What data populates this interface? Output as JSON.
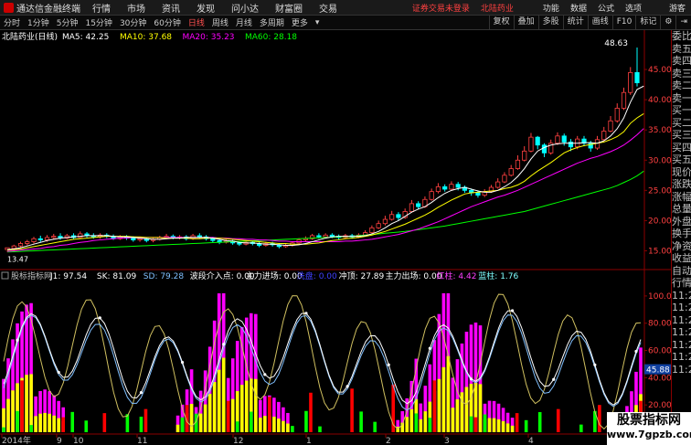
{
  "menubar": {
    "app": "通达信金融终端",
    "items": [
      "行情",
      "市场",
      "资讯",
      "发现",
      "问小达",
      "财富圈",
      "交易"
    ],
    "warning": "证券交易未登录",
    "stock_link": "北陆药业",
    "right": [
      "功能",
      "数据",
      "公式",
      "选项"
    ],
    "user": "游客"
  },
  "toolbar": {
    "periods": [
      "分时",
      "1分钟",
      "5分钟",
      "15分钟",
      "30分钟",
      "60分钟",
      "日线",
      "周线",
      "月线",
      "多周期",
      "更多"
    ],
    "active_period": "日线",
    "buttons": [
      "复权",
      "叠加",
      "多股",
      "统计",
      "画线",
      "F10",
      "标记"
    ],
    "icons": [
      "gear-icon",
      "collapse-icon"
    ]
  },
  "kline": {
    "title": "北陆药业(日线)",
    "ma_labels": [
      {
        "text": "MA5: 42.25",
        "color": "#ffffff"
      },
      {
        "text": "MA10: 37.68",
        "color": "#ffff00"
      },
      {
        "text": "MA20: 35.23",
        "color": "#ff00ff"
      },
      {
        "text": "MA60: 28.18",
        "color": "#00ff00"
      }
    ],
    "y_ticks": [
      "45.00",
      "40.00",
      "35.00",
      "30.00",
      "25.00",
      "20.00",
      "15.00"
    ],
    "high_label": "48.63",
    "low_label": "13.47",
    "candles": [
      [
        15.2,
        15.5,
        15,
        14.8
      ],
      [
        15.4,
        15.8,
        16,
        15.1
      ],
      [
        15.8,
        16.2,
        16.5,
        15.5
      ],
      [
        16.2,
        16.5,
        16.8,
        15.9
      ],
      [
        16.5,
        17,
        17.3,
        16.2
      ],
      [
        17,
        16.8,
        17.5,
        16.4
      ],
      [
        16.8,
        17.2,
        17.6,
        16.5
      ],
      [
        17.2,
        17.4,
        17.8,
        16.9
      ],
      [
        17.4,
        17.1,
        17.9,
        16.8
      ],
      [
        17.1,
        17.5,
        17.8,
        16.9
      ],
      [
        17.5,
        17.2,
        17.9,
        16.9
      ],
      [
        17.2,
        17.8,
        18.2,
        17
      ],
      [
        17.8,
        17.5,
        18.1,
        17.2
      ],
      [
        17.5,
        17.3,
        17.9,
        17
      ],
      [
        17.3,
        17.6,
        17.9,
        17
      ],
      [
        17.6,
        17.4,
        17.9,
        17.1
      ],
      [
        17.4,
        17,
        17.7,
        16.8
      ],
      [
        17,
        17.3,
        17.6,
        16.8
      ],
      [
        17.3,
        17.1,
        17.6,
        16.8
      ],
      [
        17.1,
        16.8,
        17.4,
        16.5
      ],
      [
        16.8,
        17,
        17.3,
        16.5
      ],
      [
        17,
        16.7,
        17.2,
        16.4
      ],
      [
        16.7,
        16.9,
        17.1,
        16.4
      ],
      [
        16.9,
        17.2,
        17.5,
        16.7
      ],
      [
        17.2,
        17.4,
        17.8,
        17
      ],
      [
        17.4,
        17.1,
        17.7,
        16.9
      ],
      [
        17.1,
        17.3,
        17.6,
        16.9
      ],
      [
        17.3,
        17,
        17.6,
        16.7
      ],
      [
        17,
        17.5,
        17.8,
        16.8
      ],
      [
        17.5,
        17.3,
        17.9,
        17
      ],
      [
        17.3,
        17,
        17.6,
        16.7
      ],
      [
        17,
        16.7,
        17.3,
        16.4
      ],
      [
        16.7,
        16.4,
        17,
        16.1
      ],
      [
        16.4,
        16.6,
        16.9,
        16.2
      ],
      [
        16.6,
        16.3,
        16.8,
        16
      ],
      [
        16.3,
        16.1,
        16.6,
        15.8
      ],
      [
        16.1,
        16.4,
        16.7,
        15.9
      ],
      [
        16.4,
        16.2,
        16.6,
        15.9
      ],
      [
        16.2,
        15.9,
        16.5,
        15.6
      ],
      [
        15.9,
        16.2,
        16.5,
        15.7
      ],
      [
        16.2,
        16,
        16.5,
        15.7
      ],
      [
        16,
        15.7,
        16.3,
        15.4
      ],
      [
        15.7,
        15.9,
        16.2,
        15.5
      ],
      [
        15.9,
        16.3,
        16.6,
        15.7
      ],
      [
        16.3,
        16.8,
        17.1,
        16.1
      ],
      [
        16.8,
        17,
        17.4,
        16.5
      ],
      [
        17,
        17.5,
        17.8,
        16.8
      ],
      [
        17.5,
        17.3,
        17.9,
        17
      ],
      [
        17.3,
        17.6,
        17.9,
        17.1
      ],
      [
        17.6,
        17.4,
        17.9,
        17.1
      ],
      [
        17.4,
        17.2,
        17.7,
        16.9
      ],
      [
        17.2,
        17.5,
        17.8,
        17
      ],
      [
        17.5,
        17.3,
        17.8,
        17
      ],
      [
        17.3,
        17.6,
        17.9,
        17.1
      ],
      [
        17.6,
        18,
        18.4,
        17.4
      ],
      [
        18,
        18.8,
        19.2,
        17.8
      ],
      [
        18.8,
        19.5,
        20,
        18.6
      ],
      [
        19.5,
        20.2,
        20.8,
        19.2
      ],
      [
        20.2,
        21,
        21.6,
        20
      ],
      [
        21,
        20.5,
        21.4,
        20
      ],
      [
        20.5,
        21.5,
        22,
        20.3
      ],
      [
        21.5,
        22.8,
        23.4,
        21.3
      ],
      [
        22.8,
        22.3,
        23.2,
        21.9
      ],
      [
        22.3,
        23.5,
        24,
        22.1
      ],
      [
        23.5,
        24.8,
        25.3,
        23.3
      ],
      [
        24.8,
        25.6,
        26.2,
        24.5
      ],
      [
        25.6,
        25.2,
        26,
        24.8
      ],
      [
        25.2,
        26,
        26.5,
        25
      ],
      [
        26,
        25.5,
        26.4,
        25
      ],
      [
        25.5,
        25,
        25.8,
        24.6
      ],
      [
        25,
        24.6,
        25.3,
        24.1
      ],
      [
        24.6,
        24.2,
        25,
        23.8
      ],
      [
        24.2,
        24.8,
        25.2,
        23.9
      ],
      [
        24.8,
        25.5,
        25.9,
        24.6
      ],
      [
        25.5,
        26.4,
        27,
        25.3
      ],
      [
        26.4,
        27.5,
        28,
        26.2
      ],
      [
        27.5,
        28.6,
        29.2,
        27.3
      ],
      [
        28.6,
        30,
        30.8,
        28.4
      ],
      [
        30,
        31.5,
        32.3,
        29.8
      ],
      [
        31.5,
        33.8,
        34.5,
        31.3
      ],
      [
        33.8,
        32.5,
        34,
        31.8
      ],
      [
        32.5,
        31.2,
        32.8,
        30.5
      ],
      [
        31.2,
        32.8,
        33.4,
        30.9
      ],
      [
        32.8,
        34,
        34.6,
        32.5
      ],
      [
        34,
        33,
        34.4,
        32.4
      ],
      [
        33,
        32.2,
        33.5,
        31.5
      ],
      [
        32.2,
        33.5,
        34,
        31.8
      ],
      [
        33.5,
        32.8,
        34,
        32.3
      ],
      [
        32.8,
        32,
        33.2,
        31.4
      ],
      [
        32,
        33.4,
        34,
        31.7
      ],
      [
        33.4,
        34.8,
        35.5,
        33.1
      ],
      [
        34.8,
        36.5,
        37.3,
        34.6
      ],
      [
        36.5,
        38.6,
        39.4,
        36.2
      ],
      [
        38.6,
        41.2,
        42,
        38.3
      ],
      [
        41.2,
        44.5,
        45.4,
        40.8
      ],
      [
        44.5,
        42.8,
        48.63,
        42.2
      ]
    ],
    "ma5": [
      15.2,
      15.3,
      15.5,
      15.8,
      16.1,
      16.4,
      16.7,
      16.9,
      17.1,
      17.2,
      17.3,
      17.4,
      17.5,
      17.5,
      17.5,
      17.5,
      17.4,
      17.3,
      17.3,
      17.2,
      17.1,
      17,
      16.9,
      16.9,
      17,
      17.1,
      17.1,
      17.2,
      17.2,
      17.2,
      17.2,
      17.1,
      16.9,
      16.7,
      16.6,
      16.4,
      16.3,
      16.3,
      16.2,
      16.1,
      16.1,
      16,
      15.9,
      15.9,
      16,
      16.2,
      16.5,
      16.8,
      17.1,
      17.3,
      17.4,
      17.4,
      17.4,
      17.4,
      17.5,
      17.8,
      18.2,
      18.8,
      19.5,
      20,
      20.7,
      21.4,
      21.9,
      22.3,
      23,
      23.8,
      24.5,
      25,
      25.3,
      25.5,
      25.2,
      24.9,
      24.7,
      24.7,
      25,
      25.6,
      26.3,
      27.3,
      28.6,
      30.2,
      31.5,
      32.1,
      32.5,
      32.7,
      32.8,
      32.8,
      32.8,
      32.9,
      32.9,
      32.8,
      33.2,
      34,
      35.2,
      37,
      39.6,
      41.7,
      42.25
    ],
    "ma10": [
      15.1,
      15.2,
      15.3,
      15.5,
      15.7,
      15.9,
      16.1,
      16.3,
      16.5,
      16.7,
      16.9,
      17,
      17.1,
      17.2,
      17.3,
      17.4,
      17.4,
      17.4,
      17.4,
      17.3,
      17.3,
      17.2,
      17.2,
      17.2,
      17.1,
      17.1,
      17.1,
      17.1,
      17,
      17,
      17.1,
      17.1,
      17.1,
      17,
      16.9,
      16.8,
      16.7,
      16.6,
      16.5,
      16.4,
      16.3,
      16.2,
      16.2,
      16.1,
      16.1,
      16.1,
      16.2,
      16.3,
      16.5,
      16.7,
      16.8,
      17,
      17.1,
      17.2,
      17.4,
      17.6,
      17.9,
      18.2,
      18.6,
      19,
      19.4,
      19.9,
      20.4,
      20.9,
      21.5,
      22.2,
      22.8,
      23.4,
      23.9,
      24.4,
      24.6,
      24.7,
      24.8,
      24.9,
      25,
      25.3,
      25.5,
      25.9,
      26.5,
      27.4,
      28.2,
      28.9,
      29.6,
      30.4,
      31.2,
      31.7,
      32.1,
      32.4,
      32.6,
      32.8,
      33,
      33.4,
      33.9,
      34.7,
      36.1,
      37,
      37.68
    ],
    "ma20": [
      14.9,
      15,
      15.1,
      15.2,
      15.3,
      15.4,
      15.6,
      15.7,
      15.9,
      16,
      16.2,
      16.4,
      16.5,
      16.7,
      16.8,
      16.9,
      17,
      17.1,
      17.1,
      17.2,
      17.2,
      17.2,
      17.2,
      17.2,
      17.2,
      17.2,
      17.2,
      17.2,
      17.2,
      17.2,
      17.2,
      17.2,
      17.1,
      17.1,
      17,
      17,
      16.9,
      16.9,
      16.8,
      16.8,
      16.7,
      16.6,
      16.6,
      16.5,
      16.5,
      16.5,
      16.5,
      16.5,
      16.5,
      16.5,
      16.5,
      16.6,
      16.6,
      16.7,
      16.8,
      16.9,
      17.1,
      17.3,
      17.5,
      17.7,
      18,
      18.3,
      18.6,
      19,
      19.4,
      19.8,
      20.3,
      20.8,
      21.3,
      21.8,
      22.3,
      22.7,
      23.1,
      23.5,
      23.9,
      24.2,
      24.6,
      25,
      25.5,
      26,
      26.5,
      27,
      27.5,
      28,
      28.5,
      29,
      29.5,
      29.9,
      30.3,
      30.6,
      31,
      31.4,
      31.9,
      32.5,
      33.3,
      34.2,
      35.23
    ],
    "ma60": [
      14.8,
      14.85,
      14.9,
      14.95,
      15,
      15.05,
      15.1,
      15.15,
      15.2,
      15.25,
      15.3,
      15.35,
      15.4,
      15.45,
      15.5,
      15.55,
      15.6,
      15.65,
      15.7,
      15.75,
      15.8,
      15.85,
      15.9,
      15.95,
      16,
      16.05,
      16.1,
      16.15,
      16.2,
      16.25,
      16.3,
      16.35,
      16.4,
      16.45,
      16.5,
      16.55,
      16.6,
      16.65,
      16.7,
      16.75,
      16.8,
      16.85,
      16.9,
      16.95,
      17,
      17.05,
      17.1,
      17.15,
      17.2,
      17.25,
      17.3,
      17.35,
      17.4,
      17.5,
      17.6,
      17.7,
      17.8,
      17.9,
      18,
      18.1,
      18.2,
      18.35,
      18.5,
      18.65,
      18.8,
      18.95,
      19.1,
      19.3,
      19.5,
      19.7,
      19.9,
      20.1,
      20.3,
      20.5,
      20.7,
      20.9,
      21.1,
      21.3,
      21.5,
      21.8,
      22.1,
      22.4,
      22.7,
      23,
      23.3,
      23.6,
      23.9,
      24.2,
      24.5,
      24.8,
      25.1,
      25.4,
      25.8,
      26.3,
      26.8,
      27.4,
      28.18
    ]
  },
  "indicator": {
    "name": "股标指标网",
    "labels": [
      {
        "text": "J1: 97.54",
        "color": "#ffffff"
      },
      {
        "text": "SK: 81.09",
        "color": "#ffffff"
      },
      {
        "text": "SD: 79.28",
        "color": "#80c0ff"
      },
      {
        "text": "波段介入点: 0.00",
        "color": "#ffffff"
      },
      {
        "text": "主力进场: 0.00",
        "color": "#ffffff"
      },
      {
        "text": "洗盘: 0.00",
        "color": "#4040ff"
      },
      {
        "text": "冲顶: 27.89",
        "color": "#ffffff"
      },
      {
        "text": "主力出场: 0.00",
        "color": "#ffffff"
      },
      {
        "text": "红柱: 4.42",
        "color": "#ff40ff"
      },
      {
        "text": "蓝柱: 1.76",
        "color": "#80ffff"
      }
    ],
    "y_ticks": [
      "100.0",
      "80.00",
      "60.00",
      "40.00",
      "20.00"
    ],
    "tag_value": "45.88"
  },
  "xaxis": {
    "labels": [
      "2014年",
      "9",
      "10",
      "11",
      "12",
      "1",
      "2",
      "3",
      "4"
    ]
  },
  "sidebar": {
    "items": [
      "委比",
      "卖五",
      "卖四",
      "卖三",
      "卖二",
      "卖一",
      "买一",
      "买二",
      "买三",
      "买四",
      "买五",
      "现价",
      "涨跌",
      "涨幅",
      "总量",
      "外盘",
      "换手",
      "净资",
      "收益",
      "自动",
      "行情",
      "11:2",
      "11:2",
      "11:2",
      "11:2",
      "11:2",
      "11:2",
      "11:2"
    ]
  },
  "watermark": {
    "line1": "股票指标网",
    "line2": "www.7gpzb.com"
  }
}
